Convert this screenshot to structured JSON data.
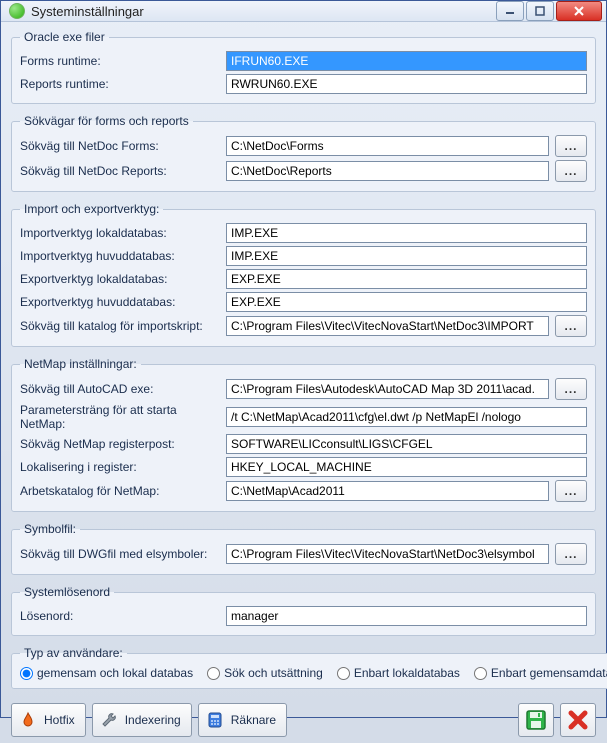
{
  "window": {
    "title": "Systeminställningar"
  },
  "groups": {
    "oracle": {
      "legend": "Oracle exe filer",
      "forms_label": "Forms runtime:",
      "forms_value": "IFRUN60.EXE",
      "reports_label": "Reports runtime:",
      "reports_value": "RWRUN60.EXE"
    },
    "paths": {
      "legend": "Sökvägar för forms och reports",
      "forms_label": "Sökväg till NetDoc Forms:",
      "forms_value": "C:\\NetDoc\\Forms",
      "reports_label": "Sökväg till NetDoc Reports:",
      "reports_value": "C:\\NetDoc\\Reports"
    },
    "import": {
      "legend": "Import och exportverktyg:",
      "imp_local_label": "Importverktyg lokaldatabas:",
      "imp_local_value": "IMP.EXE",
      "imp_main_label": "Importverktyg huvuddatabas:",
      "imp_main_value": "IMP.EXE",
      "exp_local_label": "Exportverktyg lokaldatabas:",
      "exp_local_value": "EXP.EXE",
      "exp_main_label": "Exportverktyg huvuddatabas:",
      "exp_main_value": "EXP.EXE",
      "script_label": "Sökväg till katalog för importskript:",
      "script_value": "C:\\Program Files\\Vitec\\VitecNovaStart\\NetDoc3\\IMPORT"
    },
    "netmap": {
      "legend": "NetMap inställningar:",
      "autocad_label": "Sökväg till AutoCAD exe:",
      "autocad_value": "C:\\Program Files\\Autodesk\\AutoCAD Map 3D 2011\\acad.",
      "param_label": "Parametersträng för att starta NetMap:",
      "param_value": "/t C:\\NetMap\\Acad2011\\cfg\\el.dwt /p NetMapEl /nologo",
      "regpost_label": "Sökväg NetMap registerpost:",
      "regpost_value": "SOFTWARE\\LICconsult\\LIGS\\CFGEL",
      "reglocal_label": "Lokalisering i register:",
      "reglocal_value": "HKEY_LOCAL_MACHINE",
      "workdir_label": "Arbetskatalog för NetMap:",
      "workdir_value": "C:\\NetMap\\Acad2011"
    },
    "symbol": {
      "legend": "Symbolfil:",
      "dwg_label": "Sökväg till DWGfil med elsymboler:",
      "dwg_value": "C:\\Program Files\\Vitec\\VitecNovaStart\\NetDoc3\\elsymbol"
    },
    "password": {
      "legend": "Systemlösenord",
      "label": "Lösenord:",
      "value": "manager"
    },
    "usertype": {
      "legend": "Typ av användare:",
      "opt1": "gemensam och lokal databas",
      "opt2": "Sök och utsättning",
      "opt3": "Enbart lokaldatabas",
      "opt4": "Enbart gemensamdatabas",
      "selected": "opt1"
    }
  },
  "buttons": {
    "hotfix": "Hotfix",
    "indexing": "Indexering",
    "counters": "Räknare",
    "browse_dots": "..."
  }
}
